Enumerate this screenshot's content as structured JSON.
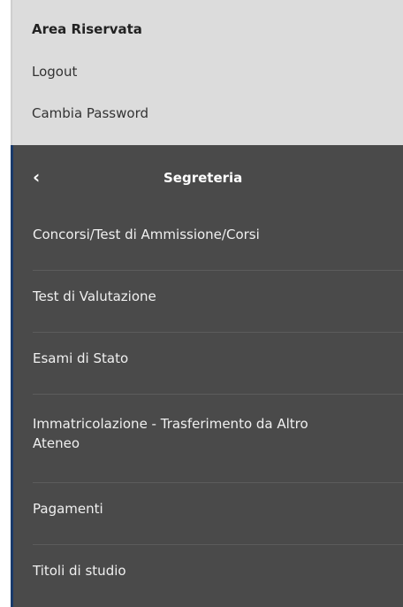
{
  "area": {
    "title": "Area Riservata",
    "logout": "Logout",
    "change_password": "Cambia Password"
  },
  "panel": {
    "back_glyph": "‹",
    "title": "Segreteria",
    "items": [
      {
        "label": "Concorsi/Test di Ammissione/Corsi"
      },
      {
        "label": "Test di Valutazione"
      },
      {
        "label": "Esami di Stato"
      },
      {
        "label": "Immatricolazione - Trasferimento da Altro Ateneo"
      },
      {
        "label": "Pagamenti"
      },
      {
        "label": "Titoli di studio"
      }
    ]
  },
  "colors": {
    "top_bg": "#dcdcdc",
    "panel_bg": "#4a4a4a",
    "accent_border": "#1a3a6a",
    "text_light": "#ffffff"
  }
}
